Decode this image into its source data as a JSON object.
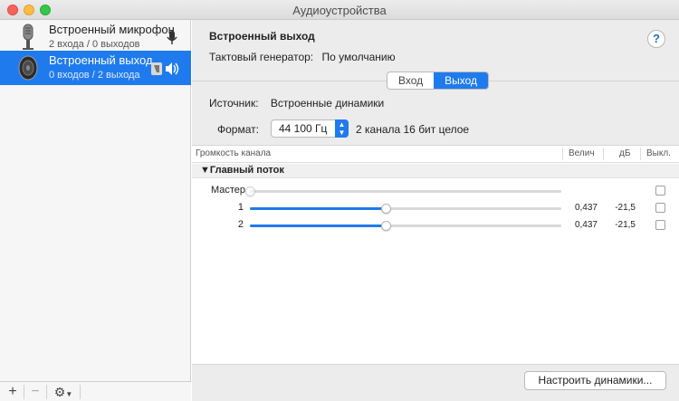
{
  "window": {
    "title": "Аудиоустройства"
  },
  "sidebar": {
    "devices": [
      {
        "name": "Встроенный микрофон",
        "subtitle": "2 входа / 0 выходов",
        "icon": "microphone-icon"
      },
      {
        "name": "Встроенный выход",
        "subtitle": "0 входов / 2 выхода",
        "icon": "speaker-icon"
      }
    ],
    "bottom": {
      "add": "+",
      "remove": "−",
      "gear": "⚙"
    }
  },
  "main": {
    "device_title": "Встроенный выход",
    "help_label": "?",
    "clock_label": "Тактовый генератор:",
    "clock_value": "По умолчанию",
    "tabs": [
      {
        "label": "Вход",
        "active": false
      },
      {
        "label": "Выход",
        "active": true
      }
    ],
    "source_label": "Источник:",
    "source_value": "Встроенные динамики",
    "format_label": "Формат:",
    "format_value": "44 100 Гц",
    "format_desc": "2 канала 16 бит целое",
    "table": {
      "headers": {
        "channel": "Громкость канала",
        "value": "Велич",
        "db": "дБ",
        "mute": "Выкл."
      },
      "group": "▼Главный поток",
      "rows": [
        {
          "label": "Мастер",
          "level": 0,
          "value": "",
          "db": ""
        },
        {
          "label": "1",
          "level": 0.437,
          "value": "0,437",
          "db": "-21,5"
        },
        {
          "label": "2",
          "level": 0.437,
          "value": "0,437",
          "db": "-21,5"
        }
      ]
    },
    "configure_button": "Настроить динамики..."
  },
  "colors": {
    "accent": "#1f7bed",
    "close": "#fc605c",
    "minimize": "#fdbc40",
    "maximize": "#34c84a"
  }
}
